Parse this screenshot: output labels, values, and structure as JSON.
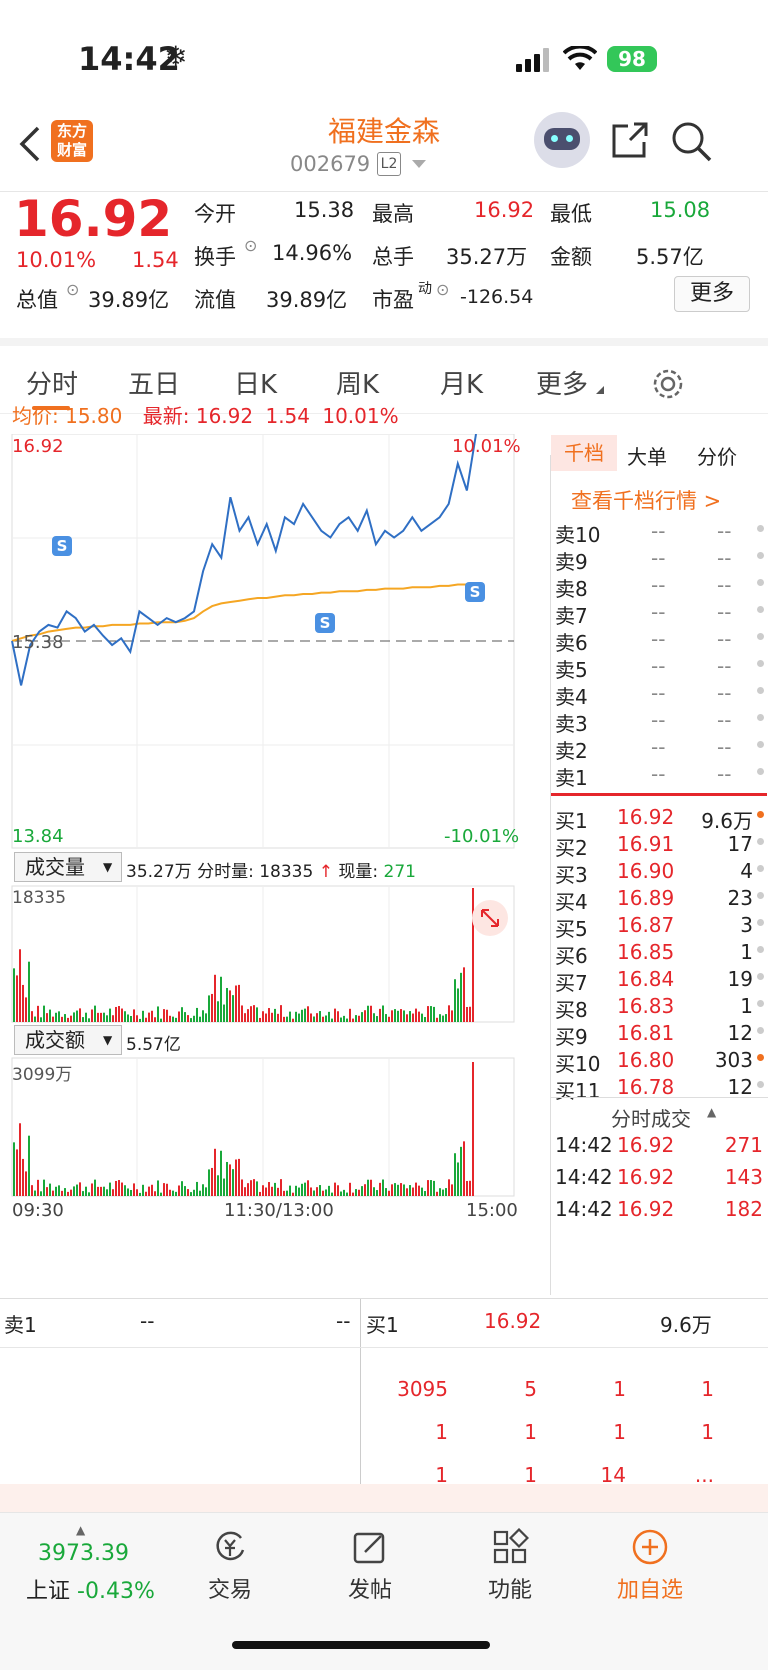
{
  "status": {
    "time": "14:42",
    "battery": "98"
  },
  "header": {
    "logo_line1": "东方",
    "logo_line2": "财富",
    "stock_name": "福建金森",
    "stock_code": "002679",
    "level_badge": "L2"
  },
  "quote": {
    "price": "16.92",
    "change_pct": "10.01%",
    "change_amt": "1.54",
    "open_label": "今开",
    "open": "15.38",
    "high_label": "最高",
    "high": "16.92",
    "low_label": "最低",
    "low": "15.08",
    "turnover_label": "换手",
    "turnover": "14.96%",
    "vol_label": "总手",
    "vol": "35.27万",
    "amount_label": "金额",
    "amount": "5.57亿",
    "mktcap_label": "总值",
    "mktcap": "39.89亿",
    "float_label": "流值",
    "float_cap": "39.89亿",
    "pe_label": "市盈",
    "pe_sup": "动",
    "pe": "-126.54",
    "more_btn": "更多"
  },
  "tabs": [
    "分时",
    "五日",
    "日K",
    "周K",
    "月K",
    "更多"
  ],
  "chart": {
    "avg_label": "均价:",
    "avg": "15.80",
    "latest_label": "最新:",
    "latest": "16.92",
    "latest_chg": "1.54",
    "latest_pct": "10.01%",
    "y_top": "16.92",
    "y_bottom": "13.84",
    "pct_top": "10.01%",
    "pct_bottom": "-10.01%",
    "y_mid": "15.38",
    "vol_dropdown": "成交量",
    "vol_total": "35.27万",
    "vol_info_label": "分时量:",
    "vol_info": "18335",
    "vol_arrow": "↑",
    "vol_now_label": "现量:",
    "vol_now": "271",
    "vol_max": "18335",
    "amt_dropdown": "成交额",
    "amt_total": "5.57亿",
    "amt_max": "3099万",
    "t_start": "09:30",
    "t_mid": "11:30/13:00",
    "t_end": "15:00",
    "s_marker": "S"
  },
  "chart_data": {
    "type": "line",
    "x_range": [
      "09:30",
      "15:00"
    ],
    "ylim": [
      13.84,
      16.92
    ],
    "prev_close": 15.38,
    "price": [
      15.38,
      15.05,
      15.35,
      15.45,
      15.5,
      15.48,
      15.6,
      15.55,
      15.45,
      15.5,
      15.42,
      15.35,
      15.4,
      15.3,
      15.6,
      15.55,
      15.5,
      15.55,
      15.52,
      15.55,
      15.6,
      15.9,
      16.1,
      16.0,
      16.45,
      16.2,
      16.3,
      16.1,
      16.25,
      16.05,
      16.3,
      16.25,
      16.4,
      16.3,
      16.2,
      16.15,
      16.25,
      16.3,
      16.2,
      16.35,
      16.1,
      16.2,
      16.15,
      16.2,
      16.3,
      16.2,
      16.25,
      16.3,
      16.4,
      16.7,
      16.5,
      16.92
    ],
    "avg": [
      15.38,
      15.4,
      15.42,
      15.43,
      15.45,
      15.46,
      15.47,
      15.48,
      15.48,
      15.49,
      15.49,
      15.5,
      15.5,
      15.5,
      15.51,
      15.51,
      15.52,
      15.52,
      15.52,
      15.53,
      15.55,
      15.6,
      15.64,
      15.66,
      15.67,
      15.68,
      15.69,
      15.7,
      15.7,
      15.71,
      15.72,
      15.72,
      15.73,
      15.73,
      15.74,
      15.74,
      15.75,
      15.75,
      15.75,
      15.76,
      15.76,
      15.77,
      15.77,
      15.77,
      15.78,
      15.78,
      15.78,
      15.79,
      15.79,
      15.8,
      15.8,
      15.8
    ]
  },
  "orderbook": {
    "tabs": [
      "千档",
      "大单",
      "分价"
    ],
    "link": "查看千档行情 >",
    "asks": [
      {
        "l": "卖10",
        "p": "--",
        "v": "--"
      },
      {
        "l": "卖9",
        "p": "--",
        "v": "--"
      },
      {
        "l": "卖8",
        "p": "--",
        "v": "--"
      },
      {
        "l": "卖7",
        "p": "--",
        "v": "--"
      },
      {
        "l": "卖6",
        "p": "--",
        "v": "--"
      },
      {
        "l": "卖5",
        "p": "--",
        "v": "--"
      },
      {
        "l": "卖4",
        "p": "--",
        "v": "--"
      },
      {
        "l": "卖3",
        "p": "--",
        "v": "--"
      },
      {
        "l": "卖2",
        "p": "--",
        "v": "--"
      },
      {
        "l": "卖1",
        "p": "--",
        "v": "--"
      }
    ],
    "bids": [
      {
        "l": "买1",
        "p": "16.92",
        "v": "9.6万"
      },
      {
        "l": "买2",
        "p": "16.91",
        "v": "17"
      },
      {
        "l": "买3",
        "p": "16.90",
        "v": "4"
      },
      {
        "l": "买4",
        "p": "16.89",
        "v": "23"
      },
      {
        "l": "买5",
        "p": "16.87",
        "v": "3"
      },
      {
        "l": "买6",
        "p": "16.85",
        "v": "1"
      },
      {
        "l": "买7",
        "p": "16.84",
        "v": "19"
      },
      {
        "l": "买8",
        "p": "16.83",
        "v": "1"
      },
      {
        "l": "买9",
        "p": "16.81",
        "v": "12"
      },
      {
        "l": "买10",
        "p": "16.80",
        "v": "303"
      },
      {
        "l": "买11",
        "p": "16.78",
        "v": "12"
      }
    ],
    "ticks_title": "分时成交",
    "ticks": [
      {
        "t": "14:42",
        "p": "16.92",
        "v": "271"
      },
      {
        "t": "14:42",
        "p": "16.92",
        "v": "143"
      },
      {
        "t": "14:42",
        "p": "16.92",
        "v": "182"
      }
    ]
  },
  "bottom": {
    "sell_label": "卖1",
    "sell_p": "--",
    "sell_v": "--",
    "buy_label": "买1",
    "buy_p": "16.92",
    "buy_v": "9.6万",
    "rows": [
      [
        "3095",
        "5",
        "1",
        "1"
      ],
      [
        "1",
        "1",
        "1",
        "1"
      ],
      [
        "1",
        "1",
        "14",
        "..."
      ]
    ]
  },
  "nav": {
    "index_val": "3973.39",
    "index_name": "上证",
    "index_pct": "-0.43%",
    "trade": "交易",
    "post": "发帖",
    "func": "功能",
    "add": "加自选"
  }
}
